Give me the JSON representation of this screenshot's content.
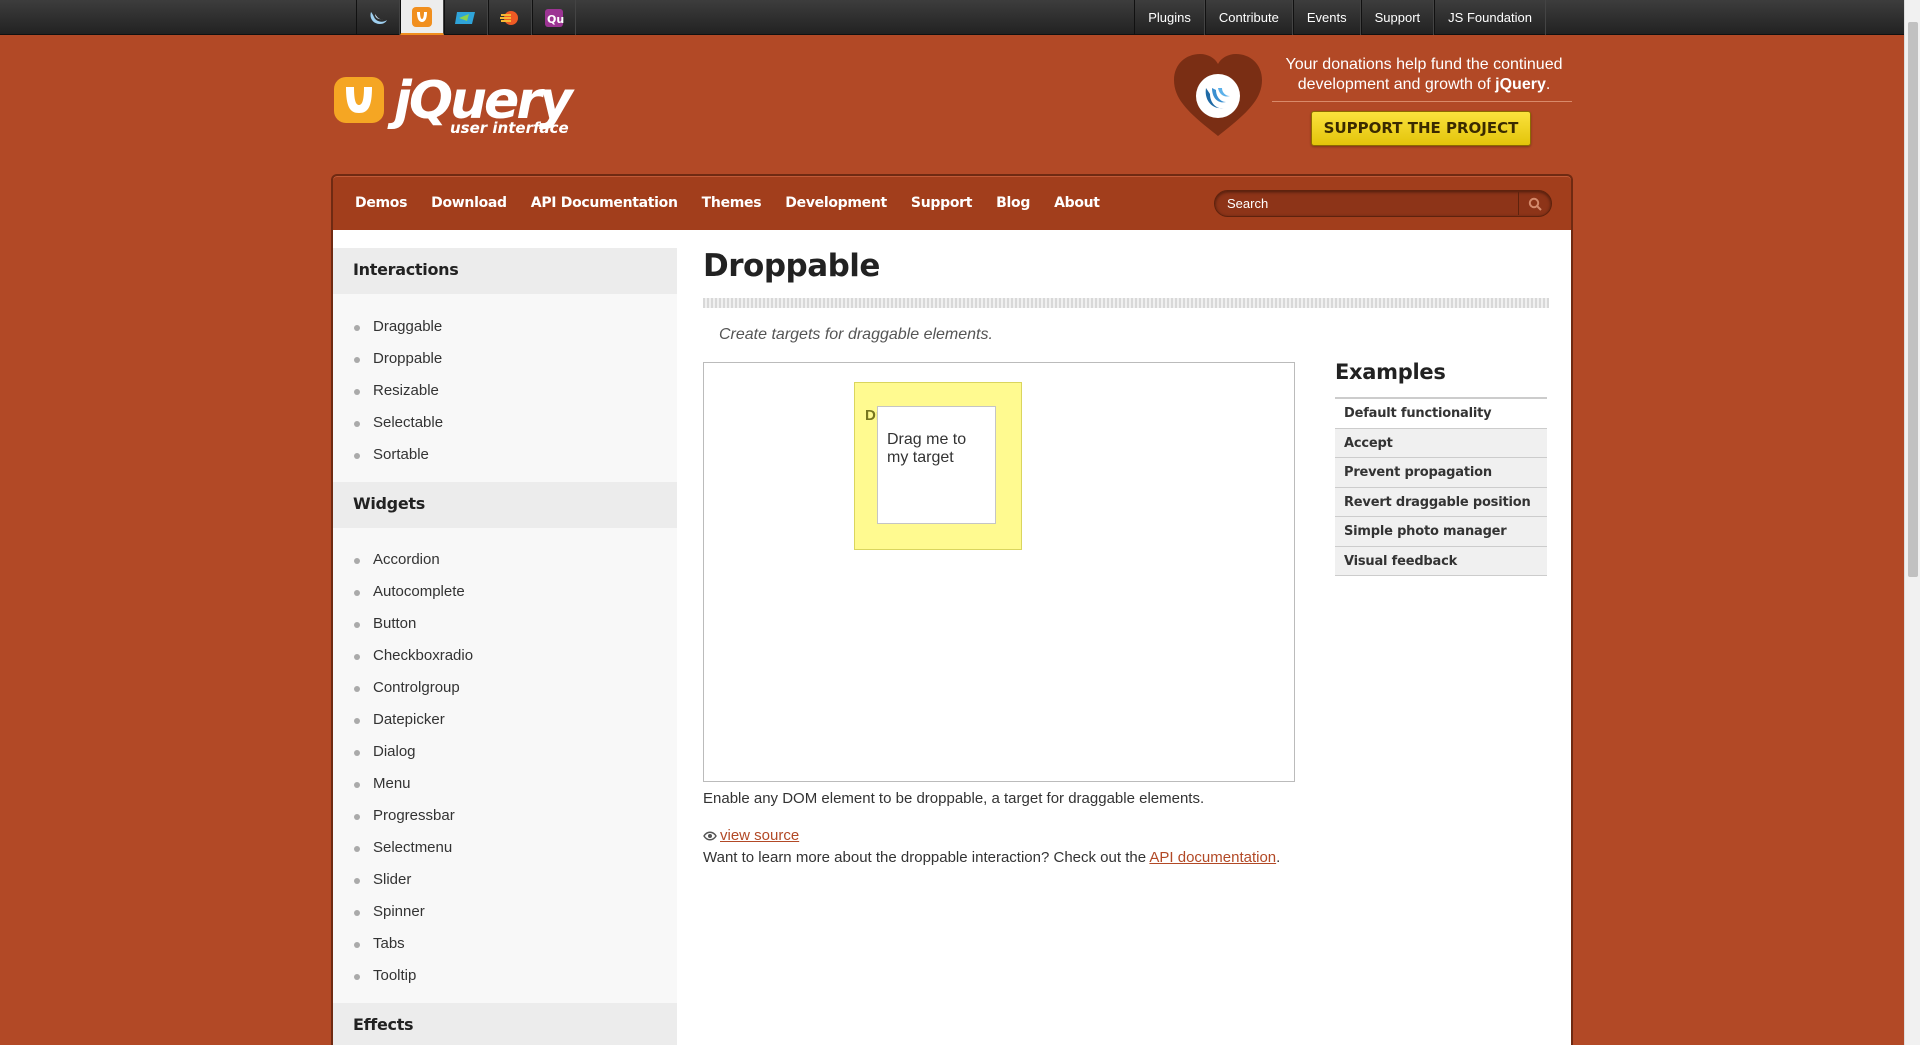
{
  "global_bar": {
    "project_icons": [
      "jquery-icon",
      "jquery-ui-icon",
      "jquery-mobile-icon",
      "sizzle-icon",
      "qunit-icon"
    ],
    "links": [
      "Plugins",
      "Contribute",
      "Events",
      "Support",
      "JS Foundation"
    ]
  },
  "header": {
    "logo_text": "jQuery",
    "logo_sub": "user interface",
    "donate_text_1": "Your donations help fund the continued development and growth of ",
    "donate_text_bold": "jQuery",
    "donate_text_end": ".",
    "support_button": "SUPPORT THE PROJECT"
  },
  "nav": {
    "items": [
      "Demos",
      "Download",
      "API Documentation",
      "Themes",
      "Development",
      "Support",
      "Blog",
      "About"
    ],
    "search_placeholder": "Search"
  },
  "sidebar": {
    "interactions_title": "Interactions",
    "interactions": [
      "Draggable",
      "Droppable",
      "Resizable",
      "Selectable",
      "Sortable"
    ],
    "widgets_title": "Widgets",
    "widgets": [
      "Accordion",
      "Autocomplete",
      "Button",
      "Checkboxradio",
      "Controlgroup",
      "Datepicker",
      "Dialog",
      "Menu",
      "Progressbar",
      "Selectmenu",
      "Slider",
      "Spinner",
      "Tabs",
      "Tooltip"
    ],
    "effects_title": "Effects"
  },
  "main": {
    "title": "Droppable",
    "subtitle": "Create targets for draggable elements.",
    "droppable_label": "Dr",
    "draggable_text": "Drag me to my target",
    "description": "Enable any DOM element to be droppable, a target for draggable elements.",
    "view_source": "view source",
    "api_text": "Want to learn more about the droppable interaction? Check out the ",
    "api_link": "API documentation",
    "api_end": "."
  },
  "examples": {
    "title": "Examples",
    "items": [
      "Default functionality",
      "Accept",
      "Prevent propagation",
      "Revert draggable position",
      "Simple photo manager",
      "Visual feedback"
    ]
  },
  "colors": {
    "brand": "#b24926",
    "nav": "#a23e1c",
    "support_button": "#f5d31e",
    "droppable": "#fffa90"
  }
}
